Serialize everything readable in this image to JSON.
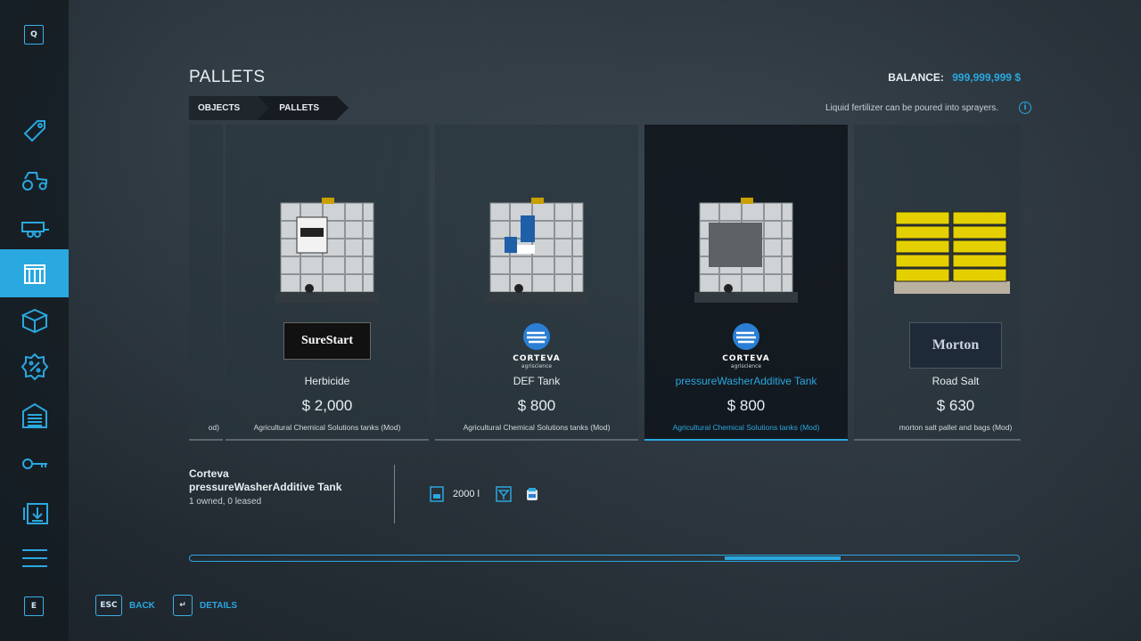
{
  "sidebar": {
    "top_key": "Q",
    "bottom_key": "E",
    "items": [
      {
        "icon": "price-tag-icon",
        "active": false
      },
      {
        "icon": "tractor-icon",
        "active": false
      },
      {
        "icon": "trailer-icon",
        "active": false
      },
      {
        "icon": "pallet-icon",
        "active": true
      },
      {
        "icon": "objects-box-icon",
        "active": false
      },
      {
        "icon": "sale-percent-icon",
        "active": false
      },
      {
        "icon": "garage-icon",
        "active": false
      },
      {
        "icon": "key-icon",
        "active": false
      },
      {
        "icon": "download-icon",
        "active": false
      },
      {
        "icon": "menu-icon",
        "active": false
      }
    ]
  },
  "header": {
    "title": "PALLETS",
    "balance_label": "BALANCE:",
    "balance_value": "999,999,999 $",
    "breadcrumb": [
      "OBJECTS",
      "PALLETS"
    ],
    "hint": "Liquid fertilizer can be poured into sprayers.",
    "info_icon": "i"
  },
  "cards": [
    {
      "name": "",
      "price": "",
      "category": "od)",
      "brand": "",
      "selected": false
    },
    {
      "name": "Herbicide",
      "price": "$ 2,000",
      "category": "Agricultural Chemical Solutions tanks (Mod)",
      "brand": "SureStart",
      "selected": false
    },
    {
      "name": "DEF Tank",
      "price": "$ 800",
      "category": "Agricultural Chemical Solutions tanks (Mod)",
      "brand": "CORTEVA",
      "brand_sub": "agriscience",
      "selected": false
    },
    {
      "name": "pressureWasherAdditive Tank",
      "price": "$ 800",
      "category": "Agricultural Chemical Solutions tanks (Mod)",
      "brand": "CORTEVA",
      "brand_sub": "agriscience",
      "selected": true
    },
    {
      "name": "Road Salt",
      "price": "$ 630",
      "category": "morton salt pallet and bags (Mod)",
      "brand": "Morton",
      "selected": false
    }
  ],
  "details": {
    "brand": "Corteva",
    "name": "pressureWasherAdditive Tank",
    "owned": "1 owned, 0 leased",
    "capacity": "2000 l"
  },
  "scroll": {
    "position": 0.75,
    "visible_fraction": 0.14
  },
  "footer": {
    "back_key": "ESC",
    "back_label": "BACK",
    "details_key": "↵",
    "details_label": "DETAILS"
  },
  "colors": {
    "accent": "#2aa8e0",
    "sidebar": "#141c22"
  }
}
